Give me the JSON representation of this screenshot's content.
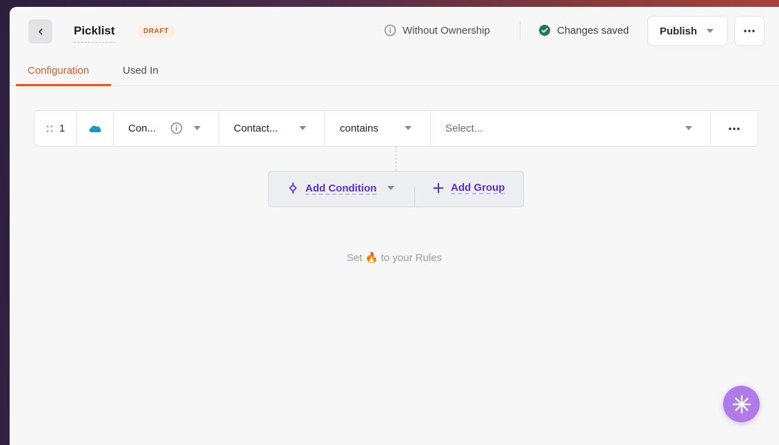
{
  "header": {
    "title": "Picklist",
    "status_badge": "DRAFT",
    "ownership_label": "Without Ownership",
    "saved_label": "Changes saved",
    "publish_label": "Publish"
  },
  "tabs": [
    {
      "label": "Configuration",
      "active": true
    },
    {
      "label": "Used In",
      "active": false
    }
  ],
  "rule": {
    "index": "1",
    "source_icon": "salesforce-cloud-icon",
    "field": "Con...",
    "object": "Contact...",
    "operator": "contains",
    "value_placeholder": "Select..."
  },
  "actions": {
    "add_condition": "Add Condition",
    "add_group": "Add Group"
  },
  "hint": {
    "before": "Set",
    "emoji": "🔥",
    "after": "to your Rules"
  },
  "colors": {
    "accent": "#e0581f",
    "action": "#5a2fd0",
    "saved": "#1f7a4f",
    "salesforce": "#1798c1",
    "fab": "#b07ae8"
  }
}
